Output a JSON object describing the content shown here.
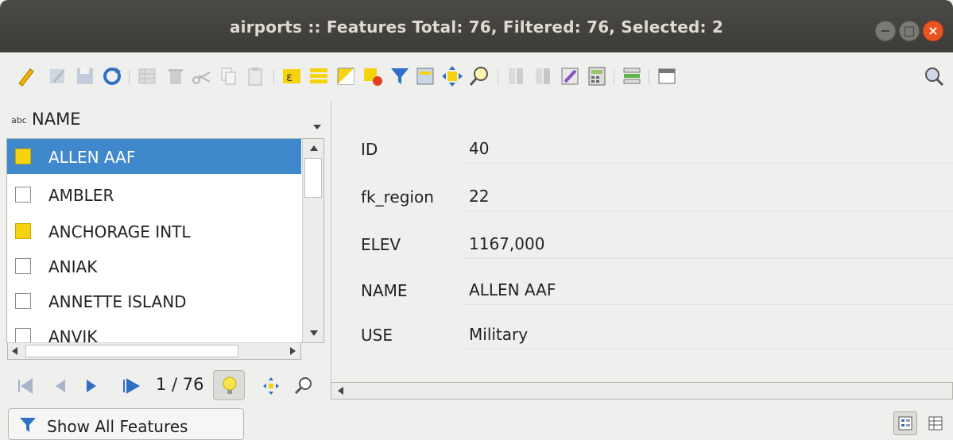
{
  "window": {
    "title": "airports :: Features Total: 76, Filtered: 76, Selected: 2",
    "controls": [
      "minimize-icon",
      "maximize-icon",
      "close-icon"
    ]
  },
  "toolbar": {
    "icons": [
      "pencil-edit-icon",
      "multi-edit-icon",
      "save-edits-icon",
      "reload-icon",
      "add-feature-icon",
      "delete-feature-icon",
      "cut-icon",
      "copy-icon",
      "paste-icon",
      "expression-select-icon",
      "select-all-icon",
      "invert-selection-icon",
      "deselect-all-icon",
      "filter-select-icon",
      "move-selection-to-top-icon",
      "pan-to-selected-icon",
      "zoom-to-selected-icon",
      "new-field-icon",
      "delete-field-icon",
      "organize-columns-icon",
      "field-calculator-icon",
      "conditional-formatting-icon",
      "dock-table-icon",
      "actions-icon"
    ]
  },
  "list": {
    "column_type": "abc",
    "column_name": "NAME",
    "items": [
      {
        "label": "ALLEN AAF",
        "selected": true,
        "marked": true
      },
      {
        "label": "AMBLER",
        "selected": false,
        "marked": false
      },
      {
        "label": "ANCHORAGE INTL",
        "selected": false,
        "marked": true
      },
      {
        "label": "ANIAK",
        "selected": false,
        "marked": false
      },
      {
        "label": "ANNETTE ISLAND",
        "selected": false,
        "marked": false
      },
      {
        "label": "ANVIK",
        "selected": false,
        "marked": false
      }
    ]
  },
  "navigation": {
    "counter": "1 / 76",
    "icons": [
      "first-record-icon",
      "previous-record-icon",
      "next-record-icon",
      "last-record-icon",
      "highlight-bulb-icon",
      "pan-to-feature-icon",
      "zoom-to-feature-icon"
    ]
  },
  "filter": {
    "label": "Show All Features"
  },
  "form": {
    "fields": [
      {
        "label": "ID",
        "value": "40"
      },
      {
        "label": "fk_region",
        "value": "22"
      },
      {
        "label": "ELEV",
        "value": "1167,000"
      },
      {
        "label": "NAME",
        "value": "ALLEN AAF"
      },
      {
        "label": "USE",
        "value": "Military"
      }
    ]
  },
  "view_switch": {
    "icons": [
      "form-view-icon",
      "table-view-icon"
    ]
  },
  "colors": {
    "selection": "#3f88cc",
    "marker_yellow": "#f6d30f",
    "close_orange": "#e95420"
  }
}
